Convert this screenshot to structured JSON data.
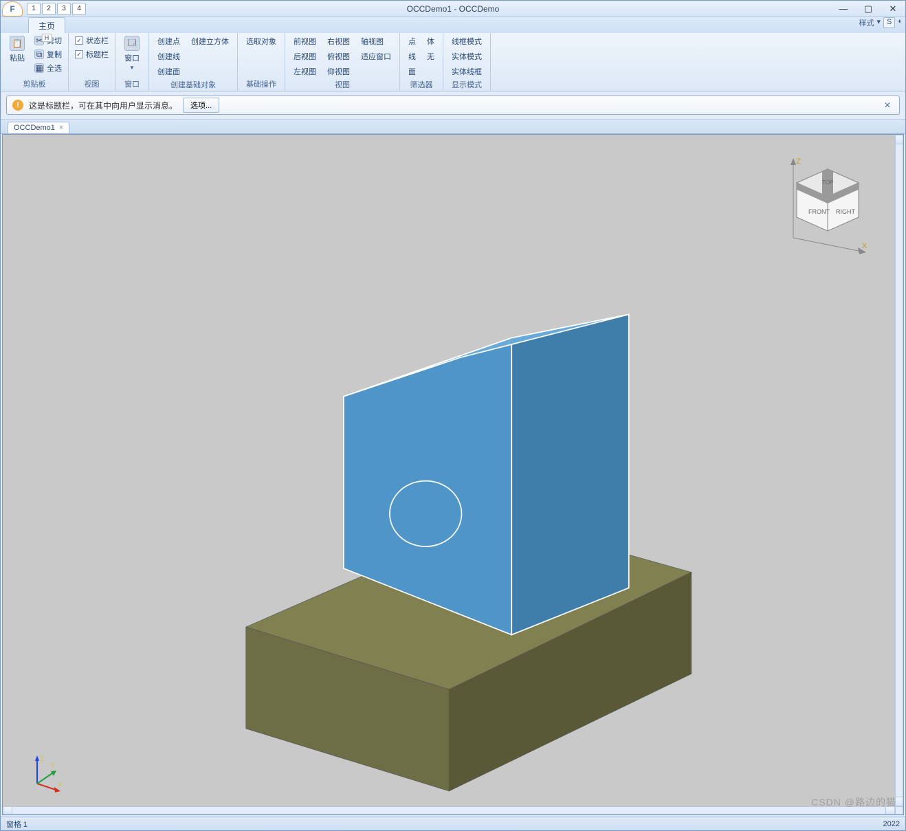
{
  "app": {
    "title": "OCCDemo1 - OCCDemo",
    "logo_letter": "F"
  },
  "qat": [
    "1",
    "2",
    "3",
    "4"
  ],
  "win_buttons": {
    "min": "—",
    "max": "▢",
    "close": "✕"
  },
  "style_menu": {
    "label": "样式",
    "key": "S"
  },
  "tabs": {
    "home": "主页",
    "home_key": "H",
    "app_key": "F"
  },
  "ribbon": {
    "clipboard": {
      "paste": "粘贴",
      "cut": "剪切",
      "copy": "复制",
      "select_all": "全选",
      "group": "剪贴板"
    },
    "view_checks": {
      "status": "状态栏",
      "caption": "标题栏",
      "group": "视图"
    },
    "window": {
      "window": "窗口",
      "group": "窗口"
    },
    "create": {
      "point": "创建点",
      "cube": "创建立方体",
      "line": "创建线",
      "face": "创建面",
      "group": "创建基础对象"
    },
    "basic_ops": {
      "select_obj": "选取对象",
      "group": "基础操作"
    },
    "views": {
      "front": "前视图",
      "back": "后视图",
      "left": "左视图",
      "right": "右视图",
      "top": "俯视图",
      "bottom": "仰视图",
      "axon": "轴视图",
      "fit": "适应窗口",
      "group": "视图"
    },
    "filter": {
      "vertex": "点",
      "body": "体",
      "edge": "线",
      "none": "无",
      "face": "面",
      "group": "筛选器"
    },
    "display": {
      "wire": "线框模式",
      "solid": "实体模式",
      "solid_wire": "实体线框",
      "group": "显示模式"
    }
  },
  "caption": {
    "text": "这是标题栏，可在其中向用户显示消息。",
    "options": "选项..."
  },
  "doc_tab": {
    "name": "OCCDemo1",
    "close": "×"
  },
  "viewcube": {
    "top": "TOP",
    "front": "FRONT",
    "right": "RIGHT",
    "z": "Z",
    "x": "X"
  },
  "axis_small": {
    "x": "X",
    "y": "Y",
    "z": "Z"
  },
  "status": {
    "pane": "窗格 1",
    "right": "2022"
  },
  "watermark": "CSDN @路边的猫"
}
